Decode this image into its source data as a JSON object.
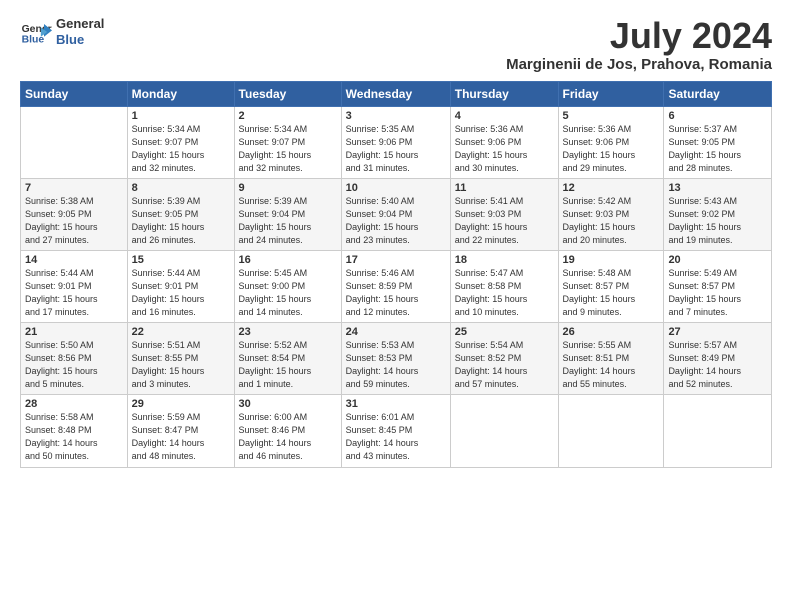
{
  "header": {
    "logo_line1": "General",
    "logo_line2": "Blue",
    "month": "July 2024",
    "location": "Marginenii de Jos, Prahova, Romania"
  },
  "weekdays": [
    "Sunday",
    "Monday",
    "Tuesday",
    "Wednesday",
    "Thursday",
    "Friday",
    "Saturday"
  ],
  "weeks": [
    [
      {
        "day": "",
        "info": ""
      },
      {
        "day": "1",
        "info": "Sunrise: 5:34 AM\nSunset: 9:07 PM\nDaylight: 15 hours\nand 32 minutes."
      },
      {
        "day": "2",
        "info": "Sunrise: 5:34 AM\nSunset: 9:07 PM\nDaylight: 15 hours\nand 32 minutes."
      },
      {
        "day": "3",
        "info": "Sunrise: 5:35 AM\nSunset: 9:06 PM\nDaylight: 15 hours\nand 31 minutes."
      },
      {
        "day": "4",
        "info": "Sunrise: 5:36 AM\nSunset: 9:06 PM\nDaylight: 15 hours\nand 30 minutes."
      },
      {
        "day": "5",
        "info": "Sunrise: 5:36 AM\nSunset: 9:06 PM\nDaylight: 15 hours\nand 29 minutes."
      },
      {
        "day": "6",
        "info": "Sunrise: 5:37 AM\nSunset: 9:05 PM\nDaylight: 15 hours\nand 28 minutes."
      }
    ],
    [
      {
        "day": "7",
        "info": "Sunrise: 5:38 AM\nSunset: 9:05 PM\nDaylight: 15 hours\nand 27 minutes."
      },
      {
        "day": "8",
        "info": "Sunrise: 5:39 AM\nSunset: 9:05 PM\nDaylight: 15 hours\nand 26 minutes."
      },
      {
        "day": "9",
        "info": "Sunrise: 5:39 AM\nSunset: 9:04 PM\nDaylight: 15 hours\nand 24 minutes."
      },
      {
        "day": "10",
        "info": "Sunrise: 5:40 AM\nSunset: 9:04 PM\nDaylight: 15 hours\nand 23 minutes."
      },
      {
        "day": "11",
        "info": "Sunrise: 5:41 AM\nSunset: 9:03 PM\nDaylight: 15 hours\nand 22 minutes."
      },
      {
        "day": "12",
        "info": "Sunrise: 5:42 AM\nSunset: 9:03 PM\nDaylight: 15 hours\nand 20 minutes."
      },
      {
        "day": "13",
        "info": "Sunrise: 5:43 AM\nSunset: 9:02 PM\nDaylight: 15 hours\nand 19 minutes."
      }
    ],
    [
      {
        "day": "14",
        "info": "Sunrise: 5:44 AM\nSunset: 9:01 PM\nDaylight: 15 hours\nand 17 minutes."
      },
      {
        "day": "15",
        "info": "Sunrise: 5:44 AM\nSunset: 9:01 PM\nDaylight: 15 hours\nand 16 minutes."
      },
      {
        "day": "16",
        "info": "Sunrise: 5:45 AM\nSunset: 9:00 PM\nDaylight: 15 hours\nand 14 minutes."
      },
      {
        "day": "17",
        "info": "Sunrise: 5:46 AM\nSunset: 8:59 PM\nDaylight: 15 hours\nand 12 minutes."
      },
      {
        "day": "18",
        "info": "Sunrise: 5:47 AM\nSunset: 8:58 PM\nDaylight: 15 hours\nand 10 minutes."
      },
      {
        "day": "19",
        "info": "Sunrise: 5:48 AM\nSunset: 8:57 PM\nDaylight: 15 hours\nand 9 minutes."
      },
      {
        "day": "20",
        "info": "Sunrise: 5:49 AM\nSunset: 8:57 PM\nDaylight: 15 hours\nand 7 minutes."
      }
    ],
    [
      {
        "day": "21",
        "info": "Sunrise: 5:50 AM\nSunset: 8:56 PM\nDaylight: 15 hours\nand 5 minutes."
      },
      {
        "day": "22",
        "info": "Sunrise: 5:51 AM\nSunset: 8:55 PM\nDaylight: 15 hours\nand 3 minutes."
      },
      {
        "day": "23",
        "info": "Sunrise: 5:52 AM\nSunset: 8:54 PM\nDaylight: 15 hours\nand 1 minute."
      },
      {
        "day": "24",
        "info": "Sunrise: 5:53 AM\nSunset: 8:53 PM\nDaylight: 14 hours\nand 59 minutes."
      },
      {
        "day": "25",
        "info": "Sunrise: 5:54 AM\nSunset: 8:52 PM\nDaylight: 14 hours\nand 57 minutes."
      },
      {
        "day": "26",
        "info": "Sunrise: 5:55 AM\nSunset: 8:51 PM\nDaylight: 14 hours\nand 55 minutes."
      },
      {
        "day": "27",
        "info": "Sunrise: 5:57 AM\nSunset: 8:49 PM\nDaylight: 14 hours\nand 52 minutes."
      }
    ],
    [
      {
        "day": "28",
        "info": "Sunrise: 5:58 AM\nSunset: 8:48 PM\nDaylight: 14 hours\nand 50 minutes."
      },
      {
        "day": "29",
        "info": "Sunrise: 5:59 AM\nSunset: 8:47 PM\nDaylight: 14 hours\nand 48 minutes."
      },
      {
        "day": "30",
        "info": "Sunrise: 6:00 AM\nSunset: 8:46 PM\nDaylight: 14 hours\nand 46 minutes."
      },
      {
        "day": "31",
        "info": "Sunrise: 6:01 AM\nSunset: 8:45 PM\nDaylight: 14 hours\nand 43 minutes."
      },
      {
        "day": "",
        "info": ""
      },
      {
        "day": "",
        "info": ""
      },
      {
        "day": "",
        "info": ""
      }
    ]
  ]
}
